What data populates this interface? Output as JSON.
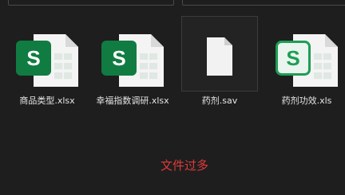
{
  "files": [
    {
      "name": "商品类型.xlsx",
      "icon": "excel-xlsx-icon"
    },
    {
      "name": "幸福指数调研.xlsx",
      "icon": "excel-xlsx-icon"
    },
    {
      "name": "药剂.sav",
      "icon": "blank-file-icon"
    },
    {
      "name": "药剂功效.xls",
      "icon": "excel-xls-icon"
    }
  ],
  "excel_icon_letter": "S",
  "status_message": "文件过多",
  "colors": {
    "background": "#1e1e1e",
    "excel_green": "#1f9d55",
    "excel_green_dark": "#107c41",
    "status_red": "#e03a3a"
  }
}
